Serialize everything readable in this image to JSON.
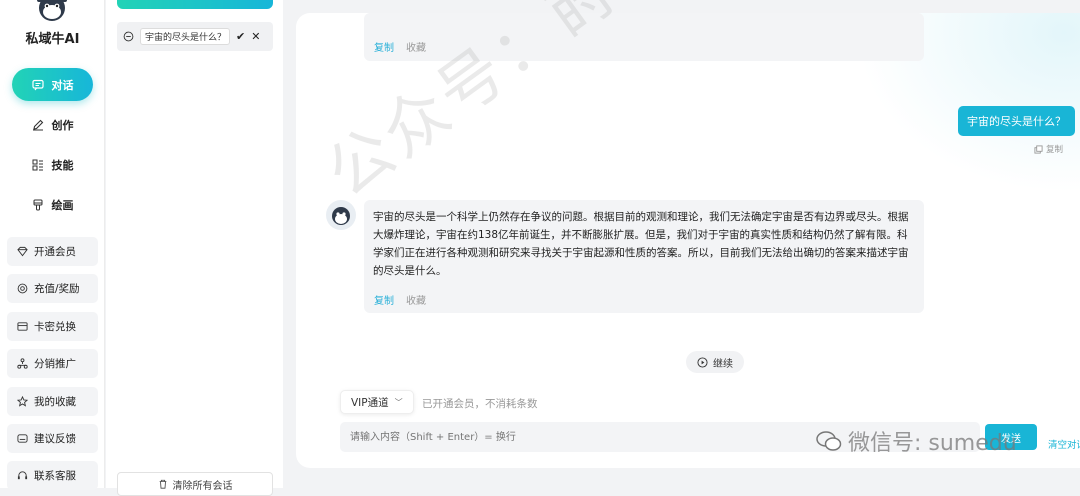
{
  "brand": {
    "name": "私域牛AI"
  },
  "nav": {
    "items": [
      {
        "label": "对话",
        "icon": "chat-icon",
        "active": true
      },
      {
        "label": "创作",
        "icon": "pen-icon"
      },
      {
        "label": "技能",
        "icon": "grid-icon"
      },
      {
        "label": "绘画",
        "icon": "brush-icon"
      }
    ],
    "buttons": [
      {
        "label": "开通会员",
        "icon": "diamond-icon"
      },
      {
        "label": "充值/奖励",
        "icon": "recharge-icon"
      },
      {
        "label": "卡密兑换",
        "icon": "card-icon"
      },
      {
        "label": "分销推广",
        "icon": "share-icon"
      },
      {
        "label": "我的收藏",
        "icon": "star-icon"
      },
      {
        "label": "建议反馈",
        "icon": "feedback-icon"
      },
      {
        "label": "联系客服",
        "icon": "headset-icon"
      }
    ]
  },
  "conversations": {
    "editing_title": "宇宙的尽头是什么？",
    "clear_all": "清除所有会话"
  },
  "chat": {
    "top_actions": {
      "copy": "复制",
      "favorite": "收藏"
    },
    "user_message": "宇宙的尽头是什么？",
    "user_copy": "复制",
    "ai_message": "宇宙的尽头是一个科学上仍然存在争议的问题。根据目前的观测和理论，我们无法确定宇宙是否有边界或尽头。根据大爆炸理论，宇宙在约138亿年前诞生，并不断膨胀扩展。但是，我们对于宇宙的真实性质和结构仍然了解有限。科学家们正在进行各种观测和研究来寻找关于宇宙起源和性质的答案。所以，目前我们无法给出确切的答案来描述宇宙的尽头是什么。",
    "ai_actions": {
      "copy": "复制",
      "favorite": "收藏"
    },
    "continue": "继续",
    "channel": "VIP通道",
    "channel_note": "已开通会员，不消耗条数",
    "input_placeholder": "请输入内容（Shift + Enter）= 换行",
    "send": "发送",
    "clear": "清空对话"
  },
  "watermark": {
    "text": "公众号：莳梦网校",
    "wechat": "微信号: sumedu"
  },
  "colors": {
    "accent": "#19b5d6",
    "accent_green": "#22d3b6"
  }
}
